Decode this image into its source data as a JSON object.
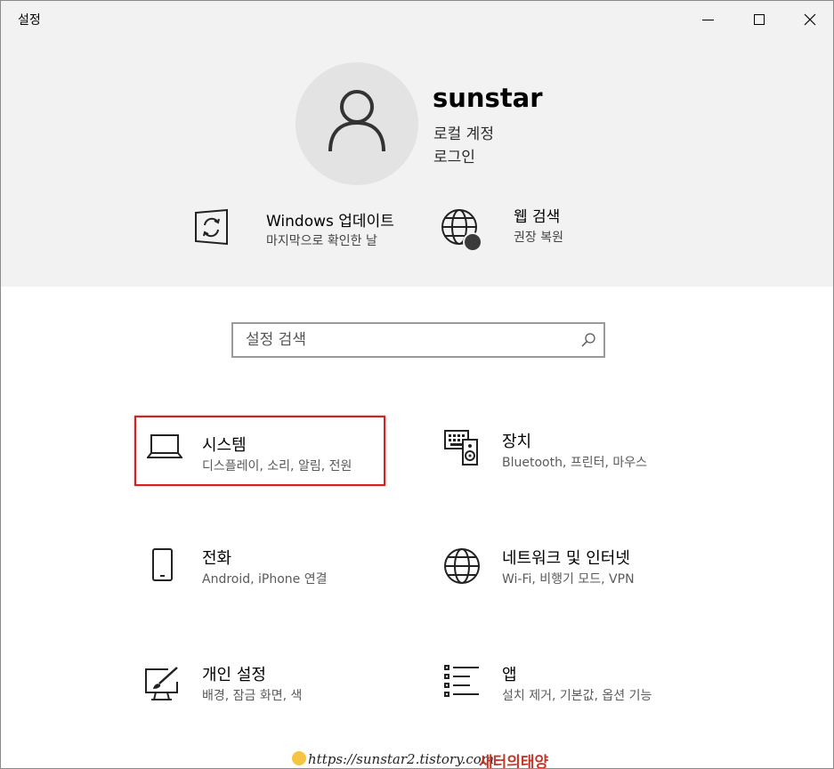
{
  "window": {
    "title": "설정"
  },
  "header": {
    "user_name": "sunstar",
    "account_type": "로컬 계정",
    "login_link": "로그인",
    "quick_items": [
      {
        "title": "Windows 업데이트",
        "subtitle": "마지막으로 확인한 날",
        "icon": "windows-update-icon"
      },
      {
        "title": "웹 검색",
        "subtitle": "권장 복원",
        "icon": "globe-icon"
      }
    ]
  },
  "search": {
    "placeholder": "설정 검색",
    "value": ""
  },
  "tiles": [
    {
      "label": "시스템",
      "desc": "디스플레이, 소리, 알림, 전원",
      "icon": "laptop-icon",
      "highlighted": true
    },
    {
      "label": "장치",
      "desc": "Bluetooth, 프린터, 마우스",
      "icon": "keyboard-speaker-icon"
    },
    {
      "label": "전화",
      "desc": "Android, iPhone 연결",
      "icon": "phone-icon"
    },
    {
      "label": "네트워크 및 인터넷",
      "desc": "Wi-Fi, 비행기 모드, VPN",
      "icon": "globe-icon"
    },
    {
      "label": "개인 설정",
      "desc": "배경, 잠금 화면, 색",
      "icon": "paint-icon"
    },
    {
      "label": "앱",
      "desc": "설치 제거, 기본값, 옵션 기능",
      "icon": "app-list-icon"
    }
  ],
  "watermark": {
    "url": "https://sunstar2.tistory.com",
    "name": "새터의태양"
  },
  "colors": {
    "highlight": "#d42020",
    "header_bg": "#f2f2f2"
  }
}
